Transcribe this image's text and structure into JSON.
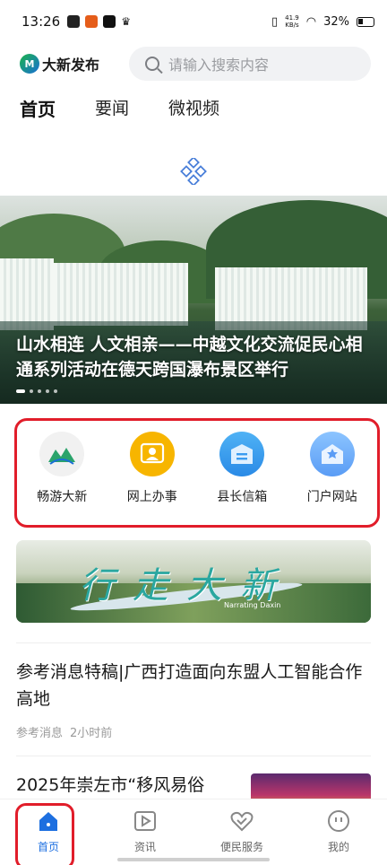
{
  "status_bar": {
    "time": "13:26",
    "net_speed": "41.9\nKB/s",
    "battery": "32%"
  },
  "header": {
    "brand": "大新发布",
    "search_placeholder": "请输入搜索内容"
  },
  "tabs": [
    "首页",
    "要闻",
    "微视频"
  ],
  "banner": {
    "title": "山水相连 人文相亲——中越文化交流促民心相通系列活动在德天跨国瀑布景区举行"
  },
  "shortcuts": [
    {
      "label": "畅游大新",
      "icon": "landscape-logo-icon"
    },
    {
      "label": "网上办事",
      "icon": "person-card-icon"
    },
    {
      "label": "县长信箱",
      "icon": "mailbox-icon"
    },
    {
      "label": "门户网站",
      "icon": "portal-house-icon"
    }
  ],
  "promo": {
    "title": "行走大新",
    "subtitle": "Narrating Daxin"
  },
  "news": [
    {
      "title": "参考消息特稿|广西打造面向东盟人工智能合作高地",
      "source": "参考消息",
      "time": "2小时前"
    },
    {
      "title": "2025年崇左市“移风易俗"
    }
  ],
  "bottom_nav": [
    {
      "label": "首页",
      "icon": "home-icon",
      "active": true
    },
    {
      "label": "资讯",
      "icon": "video-play-icon"
    },
    {
      "label": "便民服务",
      "icon": "heart-handshake-icon"
    },
    {
      "label": "我的",
      "icon": "smiley-face-icon"
    }
  ],
  "colors": {
    "accent": "#1d6fe0",
    "highlight_border": "#e11d2a",
    "wangshang": "#f7b500",
    "blue_icon": "#3a9cf0"
  }
}
